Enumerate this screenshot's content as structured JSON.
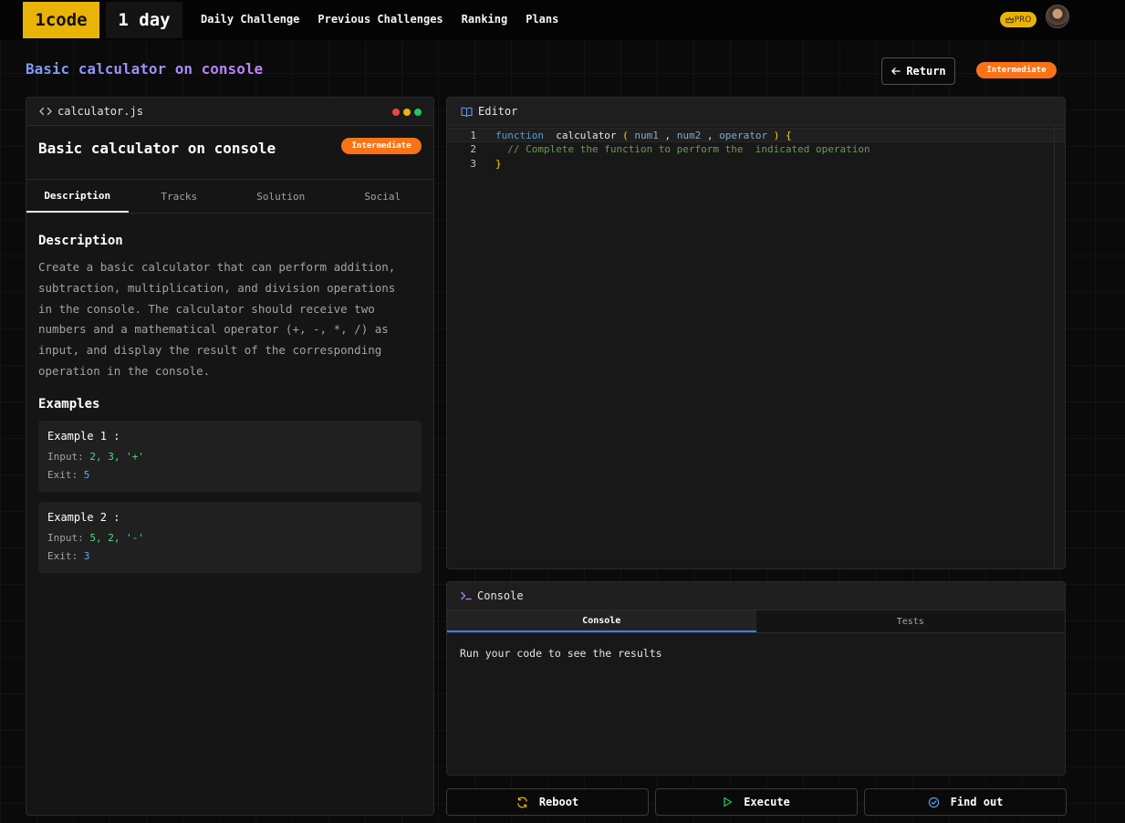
{
  "header": {
    "logo": "1code",
    "streak": "1 day",
    "nav": [
      "Daily Challenge",
      "Previous Challenges",
      "Ranking",
      "Plans"
    ],
    "pro_badge": "PRO"
  },
  "page": {
    "title": "Basic calculator on console",
    "return_label": "Return",
    "level": "Intermediate"
  },
  "problem": {
    "file_name": "calculator.js",
    "title": "Basic calculator on console",
    "level": "Intermediate",
    "tabs": [
      "Description",
      "Tracks",
      "Solution",
      "Social"
    ],
    "description_heading": "Description",
    "description": "Create a basic calculator that can perform addition, subtraction, multiplication, and division operations in the console. The calculator should receive two numbers and a mathematical operator (+, -, *, /) as input, and display the result of the corresponding operation in the console.",
    "examples_heading": "Examples",
    "examples": [
      {
        "title": "Example 1 :",
        "input_label": "Input:",
        "input": "2, 3, '+'",
        "exit_label": "Exit:",
        "exit": "5"
      },
      {
        "title": "Example 2 :",
        "input_label": "Input:",
        "input": "5, 2, '-'",
        "exit_label": "Exit:",
        "exit": "3"
      }
    ]
  },
  "editor": {
    "label": "Editor",
    "line_numbers": [
      "1",
      "2",
      "3"
    ],
    "code": {
      "keyword": "function",
      "name": "calculator",
      "open_paren": "(",
      "param1": "num1",
      "sep1": ",",
      "param2": "num2",
      "sep2": ",",
      "param3": "operator",
      "close_paren": ")",
      "open_brace": "{",
      "comment": "// Complete the function to perform the  indicated operation",
      "close_brace": "}"
    }
  },
  "console": {
    "label": "Console",
    "tabs": [
      "Console",
      "Tests"
    ],
    "output": "Run your code to see the results"
  },
  "actions": {
    "reboot": "Reboot",
    "execute": "Execute",
    "find_out": "Find out"
  },
  "colors": {
    "accent_yellow": "#eab308",
    "badge_orange": "#f97316",
    "tab_active_blue": "#3b82f6",
    "dot_red": "#ef4444",
    "dot_yellow": "#eab308",
    "dot_green": "#22c55e"
  },
  "icons": {
    "file": "code-brackets-icon",
    "editor": "book-open-icon",
    "console": "terminal-icon",
    "return": "arrow-left-icon",
    "reboot": "refresh-icon",
    "execute": "play-icon",
    "find_out": "check-circle-icon",
    "pro": "crown-icon"
  }
}
